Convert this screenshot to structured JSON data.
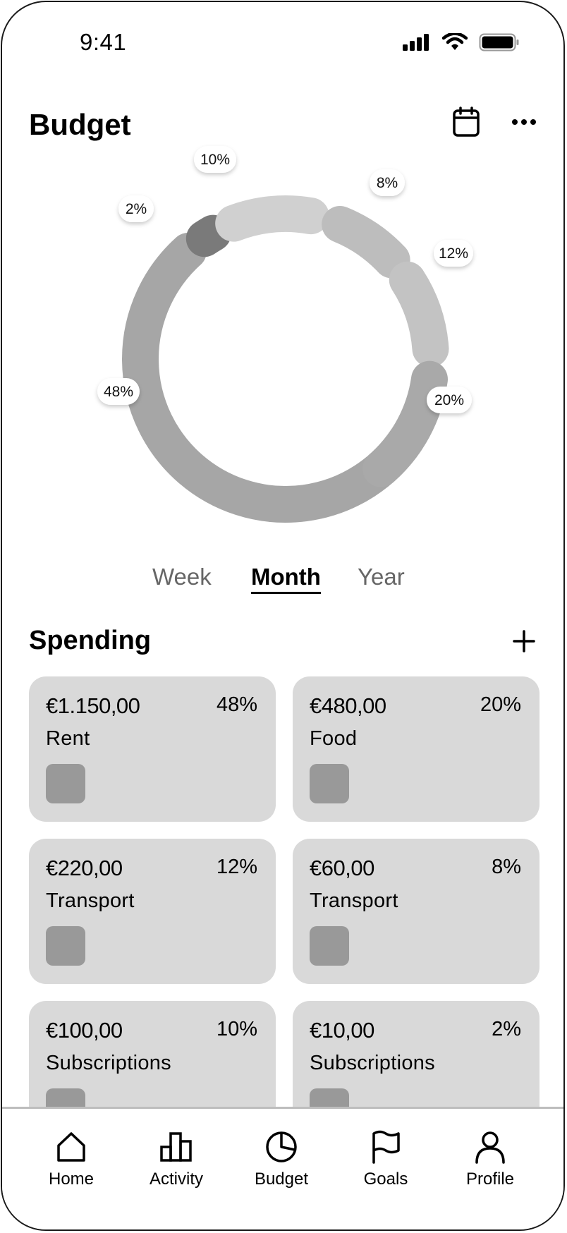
{
  "status_bar": {
    "time": "9:41"
  },
  "header": {
    "title": "Budget",
    "calendar_icon": "calendar-icon",
    "more_icon": "more-horizontal-icon"
  },
  "chart_data": {
    "type": "donut",
    "segments": [
      {
        "label": "48%",
        "value": 48,
        "color": "#a6a6a6"
      },
      {
        "label": "2%",
        "value": 2,
        "color": "#7a7a7a"
      },
      {
        "label": "10%",
        "value": 10,
        "color": "#d0d0d0"
      },
      {
        "label": "8%",
        "value": 8,
        "color": "#bdbdbd"
      },
      {
        "label": "12%",
        "value": 12,
        "color": "#c3c3c3"
      },
      {
        "label": "20%",
        "value": 20,
        "color": "#a9a9a9"
      }
    ]
  },
  "period_tabs": {
    "week": "Week",
    "month": "Month",
    "year": "Year",
    "selected": "Month"
  },
  "spending": {
    "title": "Spending",
    "add_icon": "plus-icon",
    "cards": [
      {
        "amount": "€1.150,00",
        "percent": "48%",
        "category": "Rent"
      },
      {
        "amount": "€480,00",
        "percent": "20%",
        "category": "Food"
      },
      {
        "amount": "€220,00",
        "percent": "12%",
        "category": "Transport"
      },
      {
        "amount": "€60,00",
        "percent": "8%",
        "category": "Transport"
      },
      {
        "amount": "€100,00",
        "percent": "10%",
        "category": "Subscriptions"
      },
      {
        "amount": "€10,00",
        "percent": "2%",
        "category": "Subscriptions"
      }
    ]
  },
  "nav": {
    "items": [
      {
        "label": "Home",
        "icon": "home-icon"
      },
      {
        "label": "Activity",
        "icon": "bar-chart-icon"
      },
      {
        "label": "Budget",
        "icon": "pie-chart-icon"
      },
      {
        "label": "Goals",
        "icon": "flag-icon"
      },
      {
        "label": "Profile",
        "icon": "user-icon"
      }
    ]
  }
}
